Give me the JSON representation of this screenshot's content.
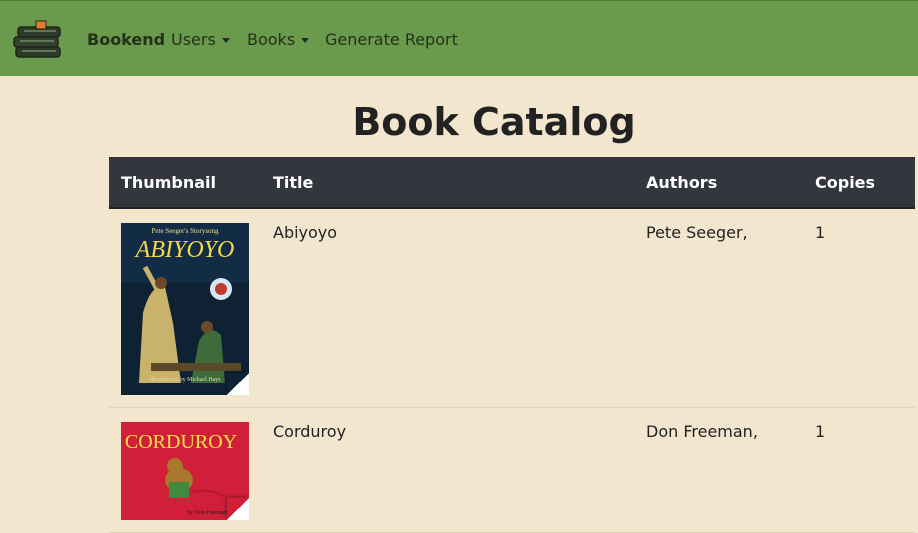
{
  "nav": {
    "brand": "Bookend",
    "users": "Users",
    "books": "Books",
    "report": "Generate Report"
  },
  "page": {
    "title": "Book Catalog"
  },
  "table": {
    "headers": [
      "Thumbnail",
      "Title",
      "Authors",
      "Copies"
    ],
    "rows": [
      {
        "title": "Abiyoyo",
        "authors": "Pete Seeger,",
        "copies": "1",
        "cover_top": "Pete Seeger's Storysong",
        "cover_title": "ABIYOYO",
        "cover_bottom": "Illustrations by Michael Hays"
      },
      {
        "title": "Corduroy",
        "authors": "Don Freeman,",
        "copies": "1",
        "cover_title": "CORDUROY",
        "cover_bottom": "by Don Freeman"
      }
    ]
  }
}
